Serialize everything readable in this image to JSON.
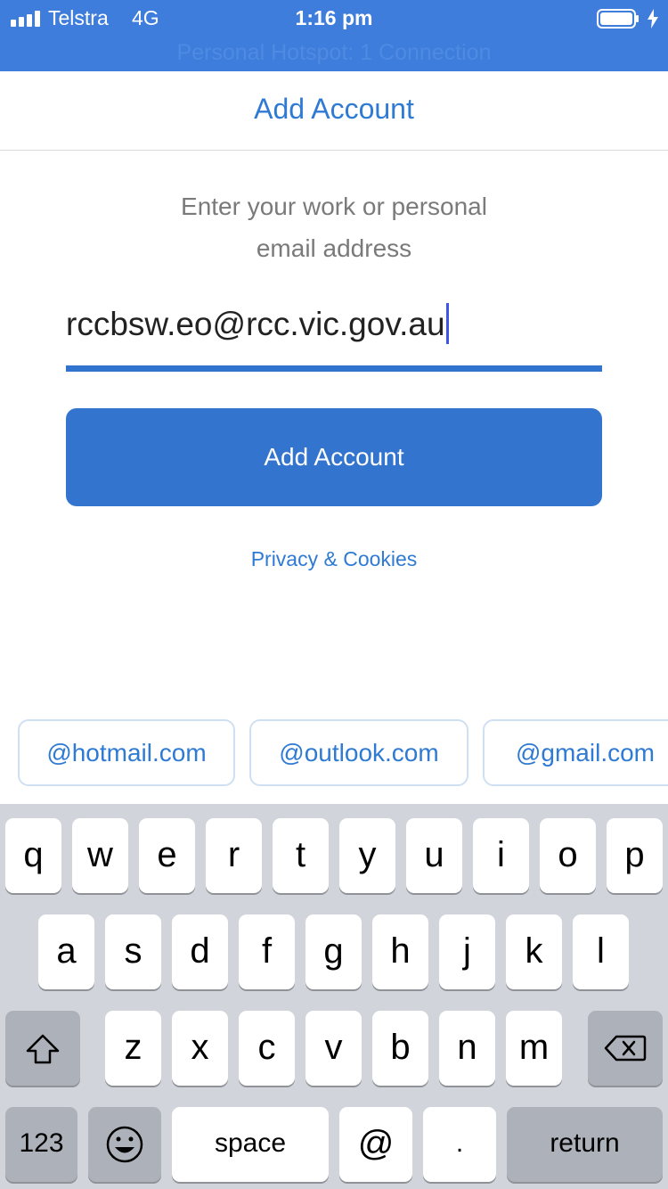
{
  "status_bar": {
    "carrier": "Telstra",
    "network": "4G",
    "time": "1:16 pm",
    "hotspot": "Personal Hotspot: 1 Connection",
    "icons": [
      "signal-icon",
      "battery-icon",
      "charging-icon"
    ]
  },
  "nav": {
    "title": "Add Account"
  },
  "form": {
    "instruction_line1": "Enter your work or personal",
    "instruction_line2": "email address",
    "email_value": "rccbsw.eo@rcc.vic.gov.au",
    "submit_label": "Add Account",
    "privacy_link": "Privacy & Cookies"
  },
  "suggestions": [
    "@hotmail.com",
    "@outlook.com",
    "@gmail.com"
  ],
  "keyboard": {
    "row1": [
      "q",
      "w",
      "e",
      "r",
      "t",
      "y",
      "u",
      "i",
      "o",
      "p"
    ],
    "row2": [
      "a",
      "s",
      "d",
      "f",
      "g",
      "h",
      "j",
      "k",
      "l"
    ],
    "row3": [
      "z",
      "x",
      "c",
      "v",
      "b",
      "n",
      "m"
    ],
    "numbers_label": "123",
    "space_label": "space",
    "at_label": "@",
    "dot_label": ".",
    "return_label": "return",
    "icons": [
      "shift-icon",
      "backspace-icon",
      "emoji-icon"
    ]
  },
  "colors": {
    "accent": "#3274ce",
    "status_bar": "#3e7ddc",
    "keyboard_bg": "#d1d4da",
    "cursor": "#3f55e8"
  }
}
